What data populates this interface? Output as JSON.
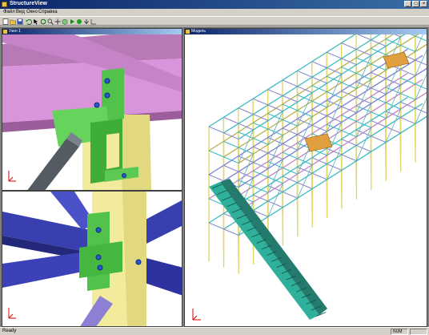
{
  "window": {
    "title": "StructureView"
  },
  "menu": [
    "Файл",
    "Вид",
    "Окно",
    "Справка"
  ],
  "toolbar": [
    "new-icon",
    "open-icon",
    "save-icon",
    "undo-icon",
    "select-icon",
    "rotate-icon",
    "zoom-icon",
    "pan-icon",
    "cube-icon",
    "play-icon",
    "stop-icon",
    "down-arrow-icon",
    "axes-icon"
  ],
  "left_pane": {
    "title": "Узел 1"
  },
  "right_pane": {
    "title": "Модель"
  },
  "status": {
    "text": "Ready",
    "cell1": "NUM",
    "cell2": ""
  },
  "colors": {
    "title": "#0a246a",
    "column": "#f3eb9c",
    "beam_pink": "#d38fd6",
    "beam_blue": "#3a3fb0",
    "plate_green": "#52c24a",
    "frame_cyan": "#3bbcc4"
  }
}
